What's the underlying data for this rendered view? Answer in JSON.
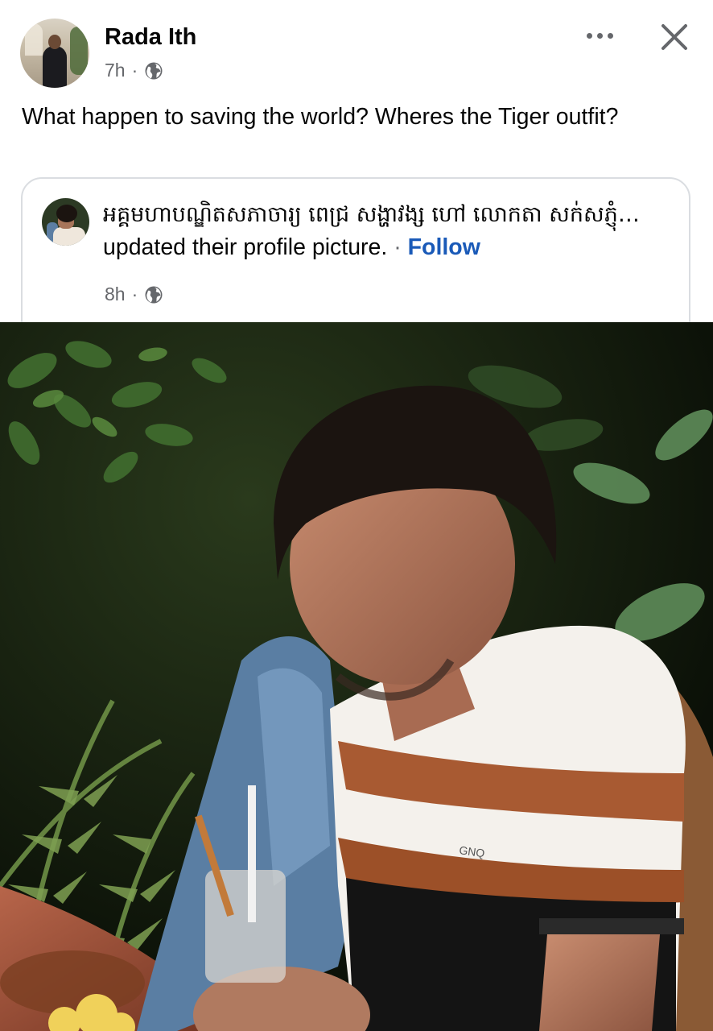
{
  "post": {
    "author": "Rada Ith",
    "time": "7h",
    "dot": "·",
    "text": "What happen to saving the world? Wheres the Tiger outfit?"
  },
  "shared_post": {
    "name": "អគ្គមហាបណ្ឌិតសភាចារ្យ ពេជ្រ សង្ហាវង្ស ហៅ លោកតា សក់សភ្ញុំ…",
    "action": " updated their profile picture.",
    "dot": " · ",
    "follow_label": "Follow",
    "time": "8h",
    "time_dot": "·",
    "photo_shirt_logo": "GNQ"
  },
  "icons": {
    "more": "more-horizontal-icon",
    "close": "close-icon",
    "privacy": "globe-icon"
  },
  "colors": {
    "follow_link": "#1a5ab8",
    "secondary_text": "#65676b",
    "card_border": "#dadde1"
  }
}
